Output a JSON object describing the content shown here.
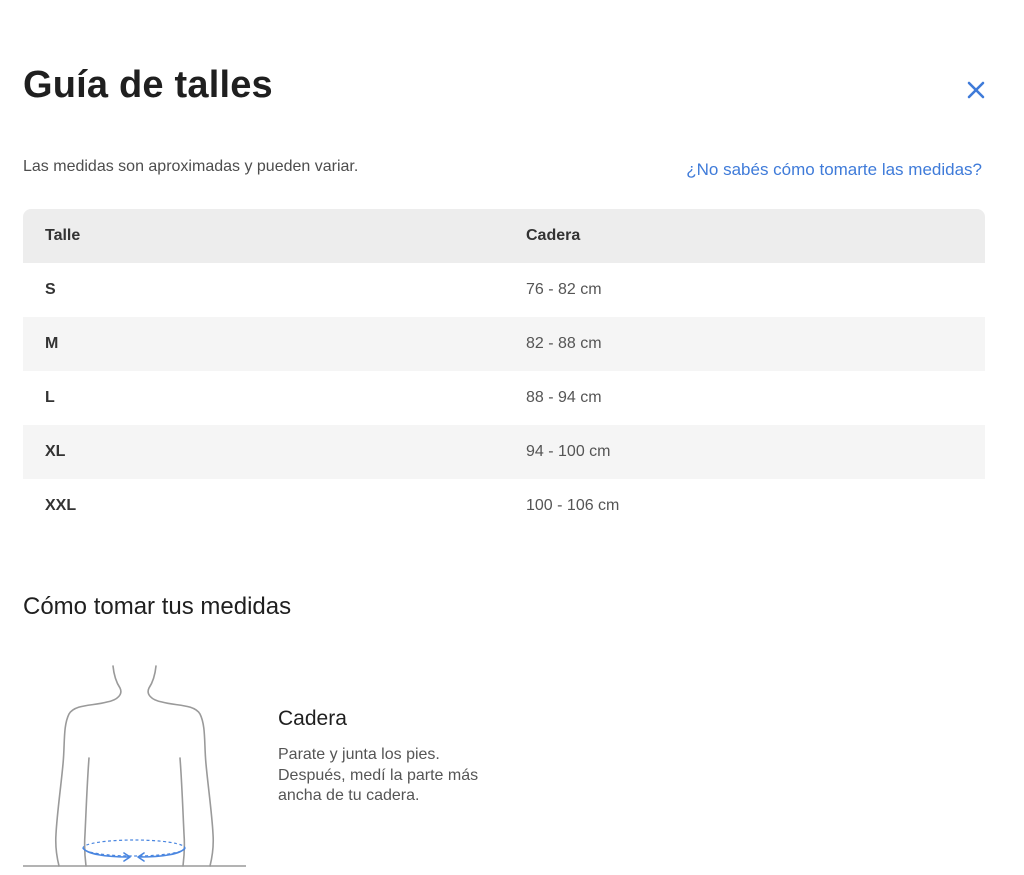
{
  "header": {
    "title": "Guía de talles",
    "close_icon": "close-icon"
  },
  "intro": {
    "note": "Las medidas son aproximadas y pueden variar.",
    "help_link": "¿No sabés cómo tomarte las medidas?"
  },
  "colors": {
    "accent": "#3f7bd9",
    "header_row": "#ededed",
    "striped_row": "#f5f5f5",
    "text_dark": "#1f1f1f"
  },
  "table": {
    "headers": [
      "Talle",
      "Cadera"
    ],
    "rows": [
      {
        "size": "S",
        "hip": "76 - 82 cm"
      },
      {
        "size": "M",
        "hip": "82 - 88 cm"
      },
      {
        "size": "L",
        "hip": "88 - 94 cm"
      },
      {
        "size": "XL",
        "hip": "94 - 100 cm"
      },
      {
        "size": "XXL",
        "hip": "100 - 106 cm"
      }
    ]
  },
  "howto": {
    "title": "Cómo tomar tus medidas",
    "figure_icon": "body-outline-hip-measurement-icon",
    "measure_title": "Cadera",
    "measure_desc": "Parate y junta los pies. Después, medí la parte más ancha de tu cadera."
  }
}
